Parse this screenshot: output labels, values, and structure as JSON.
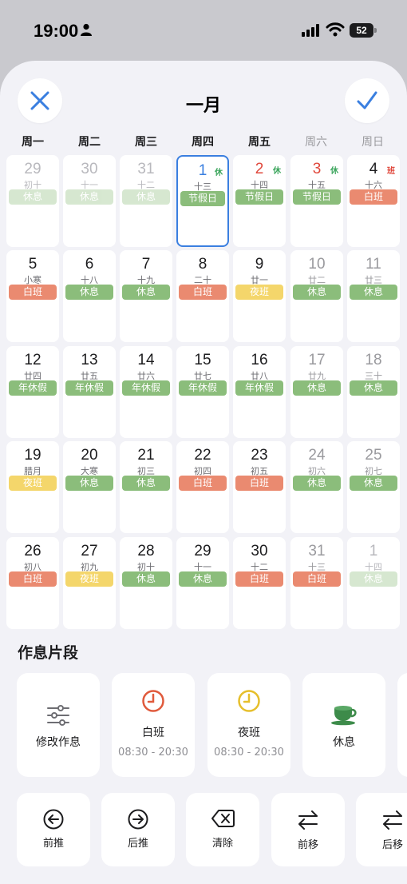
{
  "status_bar": {
    "time": "19:00",
    "battery": "52"
  },
  "header": {
    "title": "一月"
  },
  "weekdays": [
    "周一",
    "周二",
    "周三",
    "周四",
    "周五",
    "周六",
    "周日"
  ],
  "colors": {
    "rest": "#8bbd7b",
    "day_shift": "#ea8a70",
    "night_shift": "#f4d66b",
    "holiday": "#8bbd7b",
    "annual_leave": "#8bbd7b",
    "rest_badge": "#3ba55c",
    "work_badge": "#e0483c",
    "today_border": "#3a7fe0",
    "accent": "#3a7fe0"
  },
  "calendar": [
    {
      "day": "29",
      "lunar": "初十",
      "tag": "休息",
      "type": "rest",
      "faded": true
    },
    {
      "day": "30",
      "lunar": "十一",
      "tag": "休息",
      "type": "rest",
      "faded": true
    },
    {
      "day": "31",
      "lunar": "十二",
      "tag": "休息",
      "type": "rest",
      "faded": true
    },
    {
      "day": "1",
      "lunar": "十三",
      "tag": "节假日",
      "type": "holiday",
      "badge": "休",
      "badge_type": "rest",
      "today": true,
      "day_color": "#3a7fe0"
    },
    {
      "day": "2",
      "lunar": "十四",
      "tag": "节假日",
      "type": "holiday",
      "badge": "休",
      "badge_type": "rest",
      "day_color": "#e0483c"
    },
    {
      "day": "3",
      "lunar": "十五",
      "tag": "节假日",
      "type": "holiday",
      "badge": "休",
      "badge_type": "rest",
      "day_color": "#e0483c"
    },
    {
      "day": "4",
      "lunar": "十六",
      "tag": "白班",
      "type": "day_shift",
      "badge": "班",
      "badge_type": "work"
    },
    {
      "day": "5",
      "lunar": "小寒",
      "tag": "白班",
      "type": "day_shift"
    },
    {
      "day": "6",
      "lunar": "十八",
      "tag": "休息",
      "type": "rest"
    },
    {
      "day": "7",
      "lunar": "十九",
      "tag": "休息",
      "type": "rest"
    },
    {
      "day": "8",
      "lunar": "二十",
      "tag": "白班",
      "type": "day_shift"
    },
    {
      "day": "9",
      "lunar": "廿一",
      "tag": "夜班",
      "type": "night_shift"
    },
    {
      "day": "10",
      "lunar": "廿二",
      "tag": "休息",
      "type": "rest",
      "weekend": true
    },
    {
      "day": "11",
      "lunar": "廿三",
      "tag": "休息",
      "type": "rest",
      "weekend": true
    },
    {
      "day": "12",
      "lunar": "廿四",
      "tag": "年休假",
      "type": "annual_leave"
    },
    {
      "day": "13",
      "lunar": "廿五",
      "tag": "年休假",
      "type": "annual_leave"
    },
    {
      "day": "14",
      "lunar": "廿六",
      "tag": "年休假",
      "type": "annual_leave"
    },
    {
      "day": "15",
      "lunar": "廿七",
      "tag": "年休假",
      "type": "annual_leave"
    },
    {
      "day": "16",
      "lunar": "廿八",
      "tag": "年休假",
      "type": "annual_leave"
    },
    {
      "day": "17",
      "lunar": "廿九",
      "tag": "休息",
      "type": "rest",
      "weekend": true
    },
    {
      "day": "18",
      "lunar": "三十",
      "tag": "休息",
      "type": "rest",
      "weekend": true
    },
    {
      "day": "19",
      "lunar": "腊月",
      "tag": "夜班",
      "type": "night_shift"
    },
    {
      "day": "20",
      "lunar": "大寒",
      "tag": "休息",
      "type": "rest"
    },
    {
      "day": "21",
      "lunar": "初三",
      "tag": "休息",
      "type": "rest"
    },
    {
      "day": "22",
      "lunar": "初四",
      "tag": "白班",
      "type": "day_shift"
    },
    {
      "day": "23",
      "lunar": "初五",
      "tag": "白班",
      "type": "day_shift"
    },
    {
      "day": "24",
      "lunar": "初六",
      "tag": "休息",
      "type": "rest",
      "weekend": true
    },
    {
      "day": "25",
      "lunar": "初七",
      "tag": "休息",
      "type": "rest",
      "weekend": true
    },
    {
      "day": "26",
      "lunar": "初八",
      "tag": "白班",
      "type": "day_shift"
    },
    {
      "day": "27",
      "lunar": "初九",
      "tag": "夜班",
      "type": "night_shift"
    },
    {
      "day": "28",
      "lunar": "初十",
      "tag": "休息",
      "type": "rest"
    },
    {
      "day": "29",
      "lunar": "十一",
      "tag": "休息",
      "type": "rest"
    },
    {
      "day": "30",
      "lunar": "十二",
      "tag": "白班",
      "type": "day_shift"
    },
    {
      "day": "31",
      "lunar": "十三",
      "tag": "白班",
      "type": "day_shift",
      "weekend": true
    },
    {
      "day": "1",
      "lunar": "十四",
      "tag": "休息",
      "type": "rest",
      "faded": true
    }
  ],
  "segments": {
    "title": "作息片段",
    "items": [
      {
        "label": "修改作息",
        "time": "",
        "icon": "sliders-icon"
      },
      {
        "label": "白班",
        "time": "08:30 - 20:30",
        "icon": "clock-red-icon"
      },
      {
        "label": "夜班",
        "time": "08:30 - 20:30",
        "icon": "clock-yellow-icon"
      },
      {
        "label": "休息",
        "time": "",
        "icon": "tea-cup-icon"
      }
    ]
  },
  "actions": [
    {
      "label": "前推",
      "icon": "arrow-left-circle-icon"
    },
    {
      "label": "后推",
      "icon": "arrow-right-circle-icon"
    },
    {
      "label": "清除",
      "icon": "backspace-icon"
    },
    {
      "label": "前移",
      "icon": "swap-arrows-icon"
    },
    {
      "label": "后移",
      "icon": "swap-arrows-icon"
    }
  ]
}
